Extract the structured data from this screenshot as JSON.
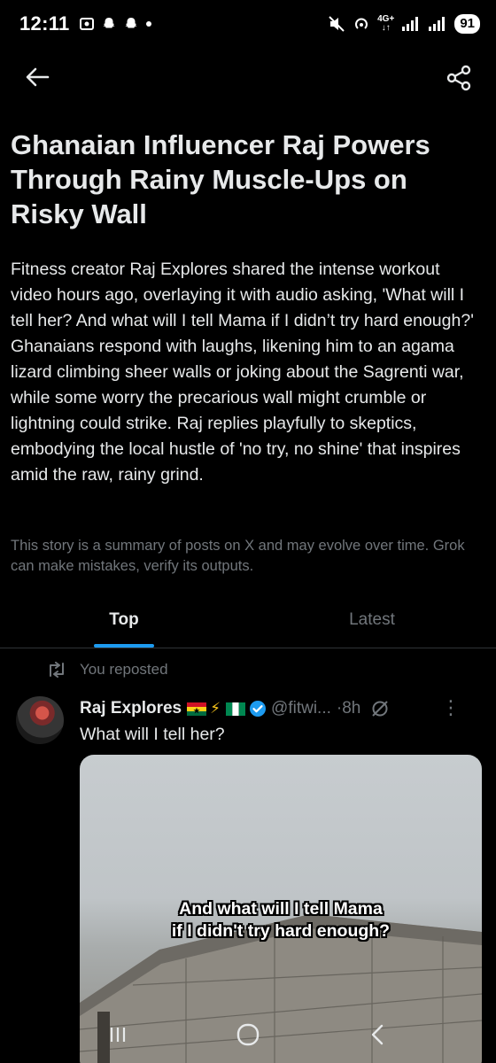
{
  "status_bar": {
    "time": "12:11",
    "network": "4G+",
    "battery": "91"
  },
  "article": {
    "headline": "Ghanaian Influencer Raj Powers Through Rainy Muscle-Ups on Risky Wall",
    "body": "Fitness creator Raj Explores shared the intense workout video hours ago, overlaying it with audio asking, 'What will I tell her? And what will I tell Mama if I didn’t try hard enough?' Ghanaians respond with laughs, likening him to an agama lizard climbing sheer walls or joking about the Sagrenti war, while some worry the precarious wall might crumble or lightning could strike. Raj replies playfully to skeptics, embodying the local hustle of 'no try, no shine' that inspires amid the raw, rainy grind.",
    "disclaimer": "This story is a summary of posts on X and may evolve over time. Grok can make mistakes, verify its outputs."
  },
  "tabs": [
    {
      "label": "Top",
      "active": true
    },
    {
      "label": "Latest",
      "active": false
    }
  ],
  "post": {
    "repost_label": "You reposted",
    "author_name": "Raj Explores",
    "handle": "@fitwi...",
    "time": "·8h",
    "text": "What will I tell her?",
    "caption_line1": "And what will I tell Mama",
    "caption_line2": "if I didn't try hard enough?"
  },
  "colors": {
    "accent": "#1d9bf0",
    "muted": "#71767b",
    "text": "#e7e9ea",
    "background": "#000000"
  },
  "icons": {
    "back": "arrow-left-icon",
    "share": "share-icon",
    "repost": "repost-icon",
    "verified": "verified-badge-icon",
    "grok": "grok-icon",
    "more": "more-vertical-icon"
  }
}
